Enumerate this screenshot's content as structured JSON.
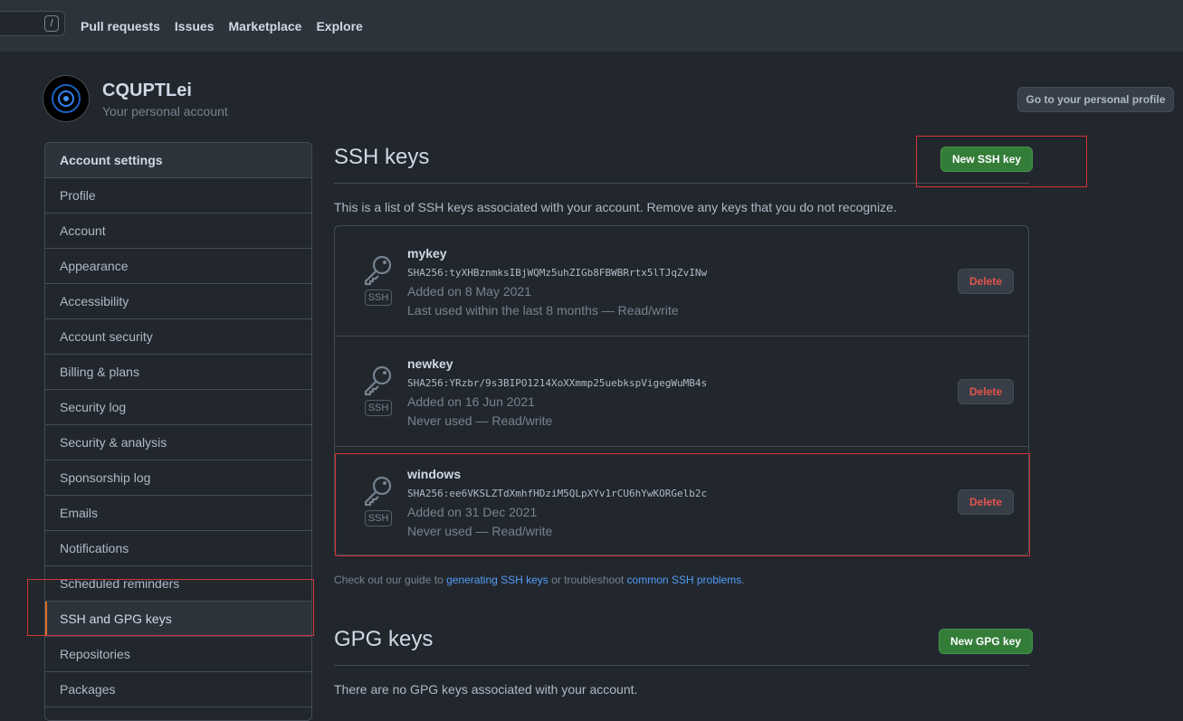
{
  "header": {
    "search_shortcut": "/",
    "nav": [
      "Pull requests",
      "Issues",
      "Marketplace",
      "Explore"
    ]
  },
  "profile": {
    "username": "CQUPTLei",
    "subtitle": "Your personal account",
    "go_profile_label": "Go to your personal profile"
  },
  "sidebar": {
    "heading": "Account settings",
    "items": [
      {
        "label": "Profile"
      },
      {
        "label": "Account"
      },
      {
        "label": "Appearance"
      },
      {
        "label": "Accessibility"
      },
      {
        "label": "Account security"
      },
      {
        "label": "Billing & plans"
      },
      {
        "label": "Security log"
      },
      {
        "label": "Security & analysis"
      },
      {
        "label": "Sponsorship log"
      },
      {
        "label": "Emails"
      },
      {
        "label": "Notifications"
      },
      {
        "label": "Scheduled reminders"
      },
      {
        "label": "SSH and GPG keys",
        "selected": true
      },
      {
        "label": "Repositories"
      },
      {
        "label": "Packages"
      }
    ]
  },
  "ssh": {
    "title": "SSH keys",
    "new_button": "New SSH key",
    "description": "This is a list of SSH keys associated with your account. Remove any keys that you do not recognize.",
    "badge": "SSH",
    "delete_label": "Delete",
    "keys": [
      {
        "name": "mykey",
        "fingerprint": "SHA256:tyXHBznmksIBjWQMz5uhZIGb8FBWBRrtx5lTJqZvINw",
        "added": "Added on 8 May 2021",
        "used": "Last used within the last 8 months — Read/write"
      },
      {
        "name": "newkey",
        "fingerprint": "SHA256:YRzbr/9s3BIPO1214XoXXmmp25uebkspVigegWuMB4s",
        "added": "Added on 16 Jun 2021",
        "used": "Never used — Read/write"
      },
      {
        "name": "windows",
        "fingerprint": "SHA256:ee6VKSLZTdXmhfHDziM5QLpXYv1rCU6hYwKORGelb2c",
        "added": "Added on 31 Dec 2021",
        "used": "Never used — Read/write"
      }
    ],
    "guide": {
      "prefix": "Check out our guide to ",
      "link1": "generating SSH keys",
      "middle": " or troubleshoot ",
      "link2": "common SSH problems",
      "suffix": "."
    }
  },
  "gpg": {
    "title": "GPG keys",
    "new_button": "New GPG key",
    "empty": "There are no GPG keys associated with your account."
  },
  "colors": {
    "background": "#22272e",
    "header": "#2d333b",
    "accent_green": "#347d39",
    "danger": "#e5534b",
    "link": "#539bf5",
    "selected_marker": "#e16f24",
    "annotation": "#d03535"
  }
}
